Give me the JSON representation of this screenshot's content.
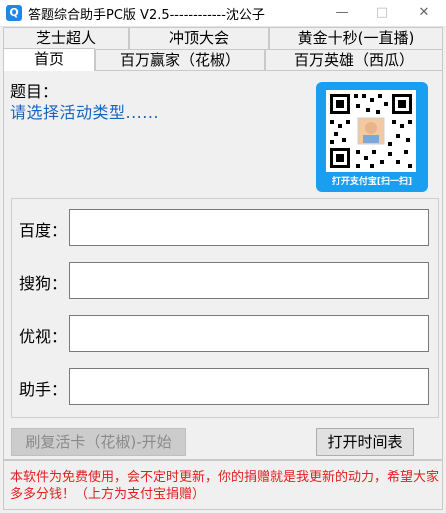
{
  "window": {
    "title": "答题综合助手PC版 V2.5------------沈公子",
    "app_icon": "Q",
    "minimize": "—",
    "maximize": "□",
    "close": "✕"
  },
  "tabs_top": [
    {
      "label": "芝士超人"
    },
    {
      "label": "冲顶大会"
    },
    {
      "label": "黄金十秒(一直播)"
    }
  ],
  "tabs_bottom": [
    {
      "label": "首页",
      "active": true
    },
    {
      "label": "百万赢家（花椒）"
    },
    {
      "label": "百万英雄（西瓜）"
    }
  ],
  "question": {
    "label": "题目：",
    "text": "请选择活动类型......"
  },
  "qr": {
    "caption": "打开支付宝[扫一扫]",
    "card_color": "#1a9ff0"
  },
  "fields": [
    {
      "label": "百度：",
      "value": ""
    },
    {
      "label": "搜狗：",
      "value": ""
    },
    {
      "label": "优视：",
      "value": ""
    },
    {
      "label": "助手：",
      "value": ""
    }
  ],
  "buttons": {
    "refresh": "刷复活卡（花椒)-开始",
    "open_schedule": "打开时间表"
  },
  "notice": {
    "text": "本软件为免费使用，会不定时更新，你的捐赠就是我更新的动力，希望大家多多分钱！（上方为支付宝捐赠）",
    "color": "#e02020"
  }
}
